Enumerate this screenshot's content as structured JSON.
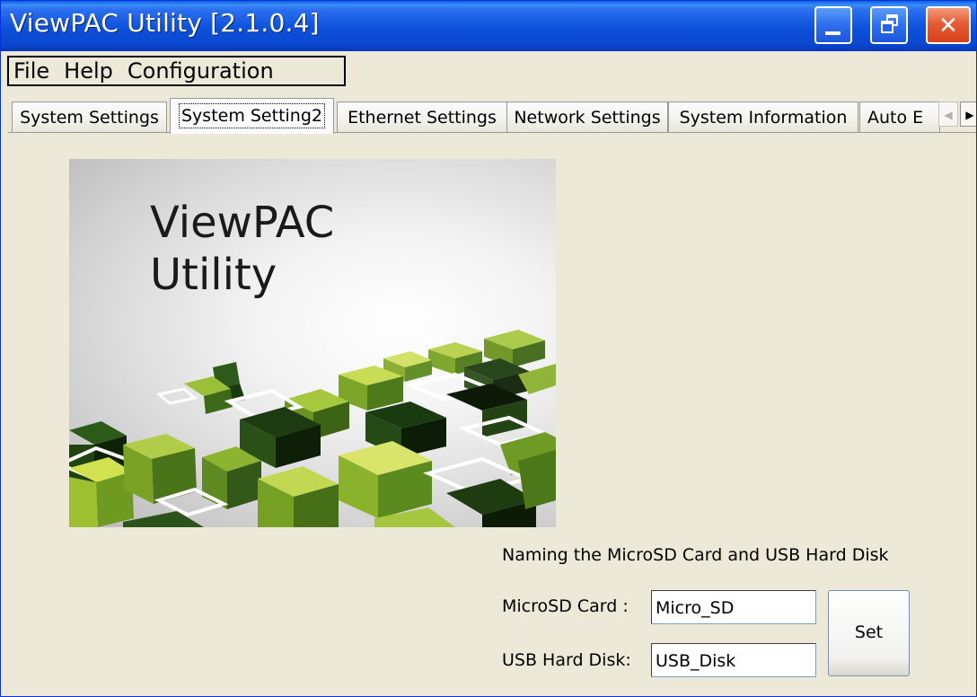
{
  "window": {
    "title": "ViewPAC Utility [2.1.0.4]",
    "controls": {
      "minimize_icon": "minimize-icon",
      "restore_icon": "restore-icon",
      "close_icon": "close-icon",
      "close_glyph": "✕"
    }
  },
  "menu": {
    "items": [
      {
        "label": "File"
      },
      {
        "label": "Help"
      },
      {
        "label": "Configuration"
      }
    ]
  },
  "tabs": {
    "items": [
      {
        "label": "System Settings",
        "active": false
      },
      {
        "label": "System Setting2",
        "active": true
      },
      {
        "label": "Ethernet Settings",
        "active": false
      },
      {
        "label": "Network Settings",
        "active": false
      },
      {
        "label": "System Information",
        "active": false
      },
      {
        "label": "Auto E",
        "active": false
      }
    ],
    "scroll_left": "◀",
    "scroll_right": "▶"
  },
  "hero": {
    "title_line1": "ViewPAC",
    "title_line2": "Utility"
  },
  "naming": {
    "heading": "Naming the MicroSD Card and USB Hard Disk",
    "microsd_label": "MicroSD Card :",
    "microsd_value": "Micro_SD",
    "usb_label": "USB Hard Disk:",
    "usb_value": "USB_Disk",
    "set_label": "Set"
  },
  "colors": {
    "title_bar": "#0a48d0",
    "window_bg": "#ece9d8",
    "close_button": "#e65b34"
  }
}
